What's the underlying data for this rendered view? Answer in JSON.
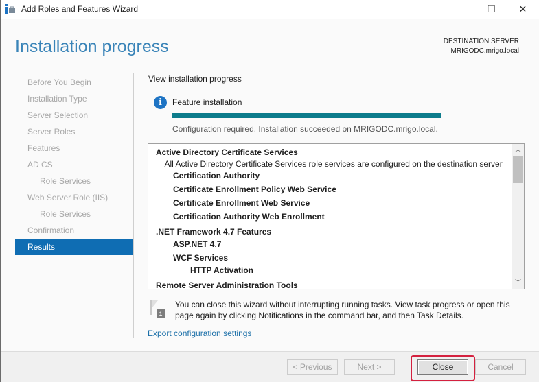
{
  "window": {
    "title": "Add Roles and Features Wizard",
    "minimize": "—",
    "maximize": "☐",
    "close": "✕"
  },
  "header": {
    "title": "Installation progress",
    "destination_label": "DESTINATION SERVER",
    "destination_server": "MRIGODC.mrigo.local"
  },
  "nav": {
    "items": [
      {
        "label": "Before You Begin",
        "sub": false,
        "active": false
      },
      {
        "label": "Installation Type",
        "sub": false,
        "active": false
      },
      {
        "label": "Server Selection",
        "sub": false,
        "active": false
      },
      {
        "label": "Server Roles",
        "sub": false,
        "active": false
      },
      {
        "label": "Features",
        "sub": false,
        "active": false
      },
      {
        "label": "AD CS",
        "sub": false,
        "active": false
      },
      {
        "label": "Role Services",
        "sub": true,
        "active": false
      },
      {
        "label": "Web Server Role (IIS)",
        "sub": false,
        "active": false
      },
      {
        "label": "Role Services",
        "sub": true,
        "active": false
      },
      {
        "label": "Confirmation",
        "sub": false,
        "active": false
      },
      {
        "label": "Results",
        "sub": false,
        "active": true
      }
    ]
  },
  "main": {
    "section_label": "View installation progress",
    "feature_label": "Feature installation",
    "progress_percent": 100,
    "progress_color": "#0d7c8c",
    "status": "Configuration required. Installation succeeded on MRIGODC.mrigo.local.",
    "results": [
      {
        "text": "Active Directory Certificate Services",
        "level": 0,
        "bold": true
      },
      {
        "text": "All Active Directory Certificate Services role services are configured on the destination server",
        "level": 0.5,
        "bold": false
      },
      {
        "text": "Certification Authority",
        "level": 1,
        "bold": true
      },
      {
        "text": "Certificate Enrollment Policy Web Service",
        "level": 1,
        "bold": true
      },
      {
        "text": "Certificate Enrollment Web Service",
        "level": 1,
        "bold": true
      },
      {
        "text": "Certification Authority Web Enrollment",
        "level": 1,
        "bold": true
      },
      {
        "text": ".NET Framework 4.7 Features",
        "level": 0,
        "bold": true
      },
      {
        "text": "ASP.NET 4.7",
        "level": 1,
        "bold": true
      },
      {
        "text": "WCF Services",
        "level": 1,
        "bold": true
      },
      {
        "text": "HTTP Activation",
        "level": 2,
        "bold": true
      },
      {
        "text": "Remote Server Administration Tools",
        "level": 0,
        "bold": true
      }
    ],
    "note": "You can close this wizard without interrupting running tasks. View task progress or open this page again by clicking Notifications in the command bar, and then Task Details.",
    "note_badge": "1",
    "export_link": "Export configuration settings"
  },
  "footer": {
    "previous": "< Previous",
    "next": "Next >",
    "close": "Close",
    "cancel": "Cancel"
  }
}
